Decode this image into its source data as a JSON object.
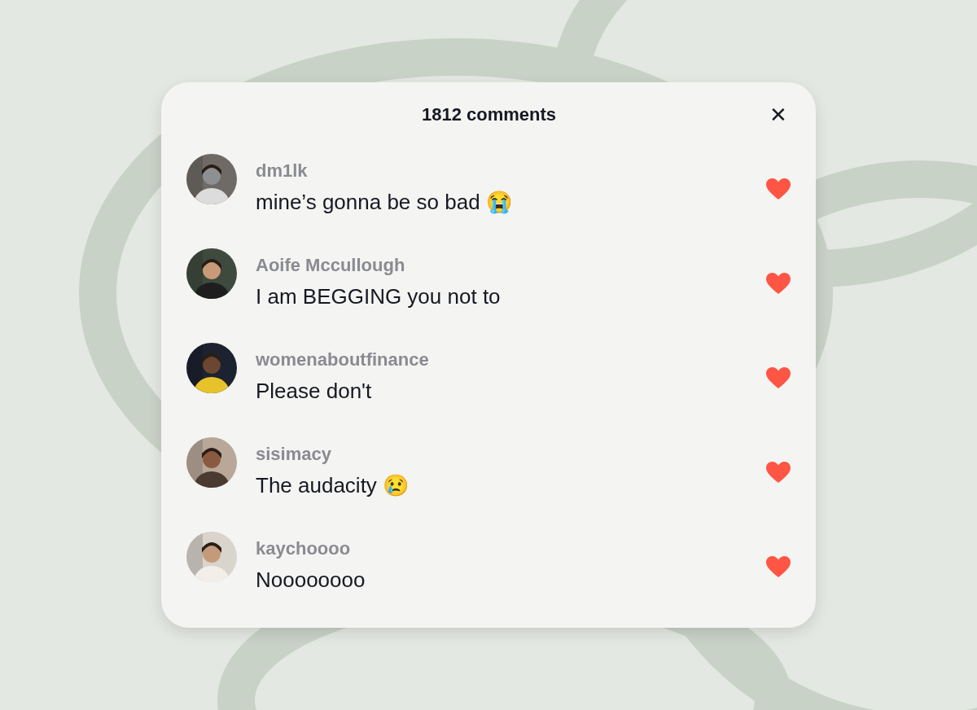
{
  "panel": {
    "title": "1812 comments",
    "close": "✕"
  },
  "comments": [
    {
      "username": "dm1lk",
      "text": "mine’s gonna be so bad 😭",
      "liked": true
    },
    {
      "username": "Aoife Mccullough",
      "text": "I am BEGGING you not to",
      "liked": true
    },
    {
      "username": "womenaboutfinance",
      "text": "Please don't",
      "liked": true
    },
    {
      "username": "sisimacy",
      "text": "The audacity 😢",
      "liked": true
    },
    {
      "username": "kaychoooo",
      "text": "Noooooooo",
      "liked": true
    }
  ]
}
